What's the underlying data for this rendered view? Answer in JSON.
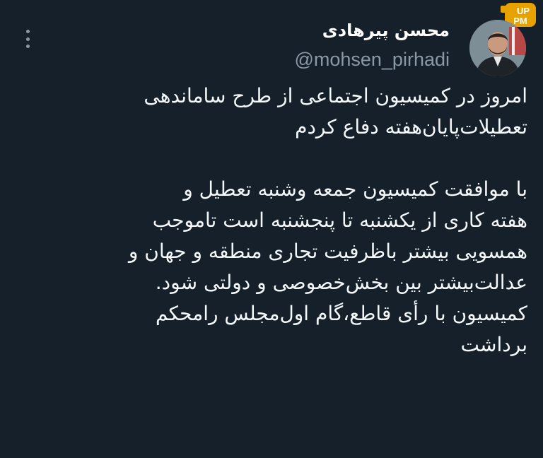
{
  "author": {
    "display_name": "محسن پیرهادی",
    "handle": "@mohsen_pirhadi"
  },
  "watermark": {
    "text": "UP PM"
  },
  "tweet": {
    "lines": [
      "امروز در کمیسیون اجتماعی از طرح ساماندهی",
      "تعطیلات‌پایان‌هفته دفاع کردم",
      "",
      "با موافقت کمیسیون جمعه وشنبه تعطیل و",
      "هفته کاری از یکشنبه تا پنجشنبه است تاموجب",
      "همسویی بیشتر باظرفیت تجاری منطقه و جهان و",
      "عدالت‌بیشتر بین بخش‌خصوصی و دولتی شود.",
      "کمیسیون با رأی قاطع،گام اول‌مجلس رامحکم",
      "برداشت"
    ]
  },
  "colors": {
    "background": "#15202b",
    "text": "#f5f8fa",
    "secondary": "#8b98a5",
    "watermark": "#e8a200"
  },
  "icons": {
    "more": "more-vertical-icon"
  }
}
